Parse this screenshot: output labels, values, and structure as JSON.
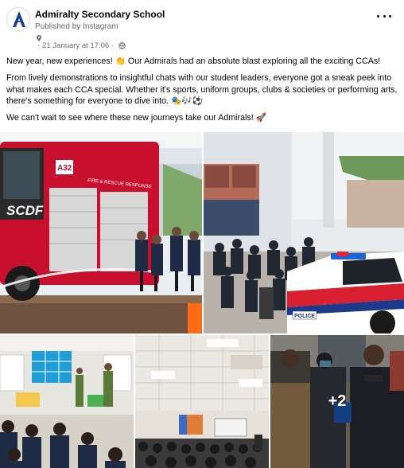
{
  "post": {
    "page_name": "Admiralty Secondary School",
    "published_via": "Published by Instagram",
    "timestamp": "21 January at 17:06",
    "more_icon": "more-horizontal-icon",
    "globe_icon": "globe-icon",
    "paragraphs": [
      "New year, new experiences! 👏 Our Admirals had an absolute blast exploring all the exciting CCAs!",
      "From lively demonstrations to insightful chats with our student leaders, everyone got a sneak peek into what makes each CCA special. Whether it's sports, uniform groups, clubs & societies or performing arts, there's something for everyone to dive into. 🎭🎶⚽",
      "We can't wait to see where these new journeys take our Admirals! 🚀"
    ]
  },
  "photos": {
    "more_count_label": "+2",
    "fire_truck_text": "FIRE & RESCUE RESPONSE",
    "scdf_label": "SCDF",
    "truck_number": "A32",
    "police_label": "POLICE"
  },
  "colors": {
    "text": "#050505",
    "muted": "#65676b",
    "truck_red": "#c8102e"
  }
}
